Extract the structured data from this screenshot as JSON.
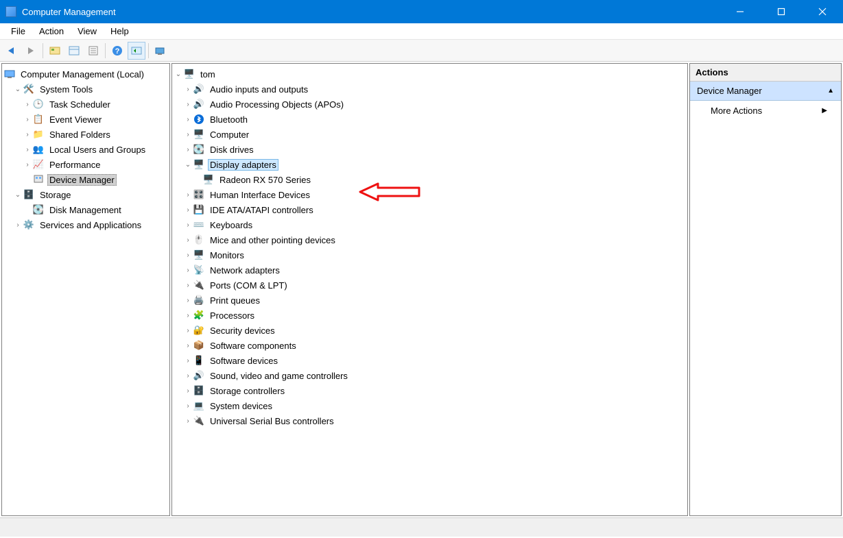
{
  "window": {
    "title": "Computer Management"
  },
  "menu": [
    "File",
    "Action",
    "View",
    "Help"
  ],
  "left_tree": {
    "root": "Computer Management (Local)",
    "system_tools": "System Tools",
    "system_tools_children": [
      "Task Scheduler",
      "Event Viewer",
      "Shared Folders",
      "Local Users and Groups",
      "Performance",
      "Device Manager"
    ],
    "storage": "Storage",
    "storage_children": [
      "Disk Management"
    ],
    "services": "Services and Applications"
  },
  "mid_tree": {
    "root": "tom",
    "categories": [
      "Audio inputs and outputs",
      "Audio Processing Objects (APOs)",
      "Bluetooth",
      "Computer",
      "Disk drives",
      "Display adapters",
      "Human Interface Devices",
      "IDE ATA/ATAPI controllers",
      "Keyboards",
      "Mice and other pointing devices",
      "Monitors",
      "Network adapters",
      "Ports (COM & LPT)",
      "Print queues",
      "Processors",
      "Security devices",
      "Software components",
      "Software devices",
      "Sound, video and game controllers",
      "Storage controllers",
      "System devices",
      "Universal Serial Bus controllers"
    ],
    "display_adapter_child": "Radeon RX 570 Series"
  },
  "actions": {
    "header": "Actions",
    "section": "Device Manager",
    "more": "More Actions"
  }
}
